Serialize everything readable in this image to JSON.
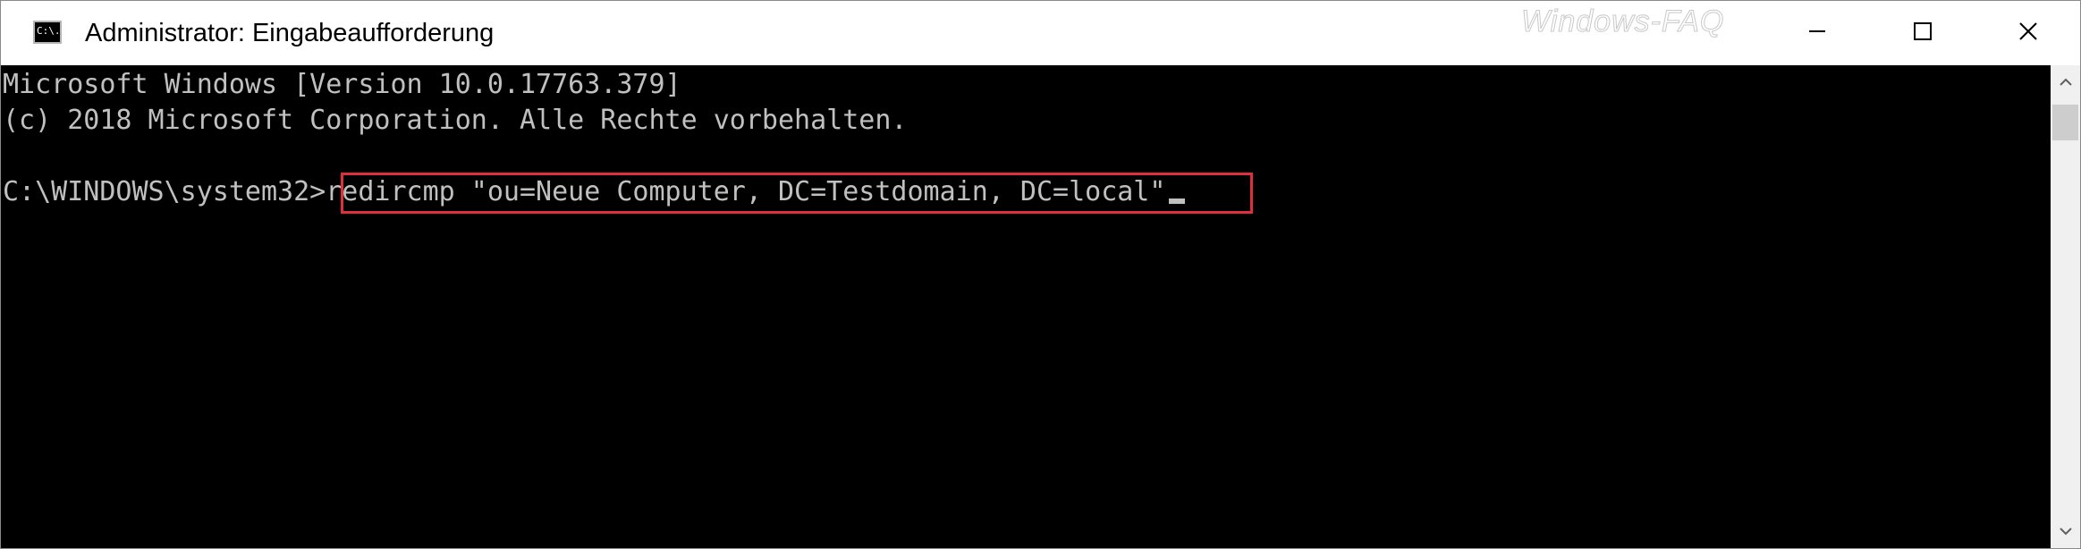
{
  "window": {
    "title": "Administrator: Eingabeaufforderung",
    "icon_label": "C:\\.",
    "watermark": "Windows-FAQ"
  },
  "controls": {
    "minimize_icon": "minimize-icon",
    "maximize_icon": "maximize-icon",
    "close_icon": "close-icon"
  },
  "console": {
    "line1": "Microsoft Windows [Version 10.0.17763.379]",
    "line2": "(c) 2018 Microsoft Corporation. Alle Rechte vorbehalten.",
    "prompt": "C:\\WINDOWS\\system32>",
    "command": "redircmp \"ou=Neue Computer, DC=Testdomain, DC=local\""
  },
  "colors": {
    "console_background": "#000000",
    "console_text": "#c0c0c0",
    "highlight_border": "#e02f3a",
    "titlebar": "#ffffff"
  }
}
